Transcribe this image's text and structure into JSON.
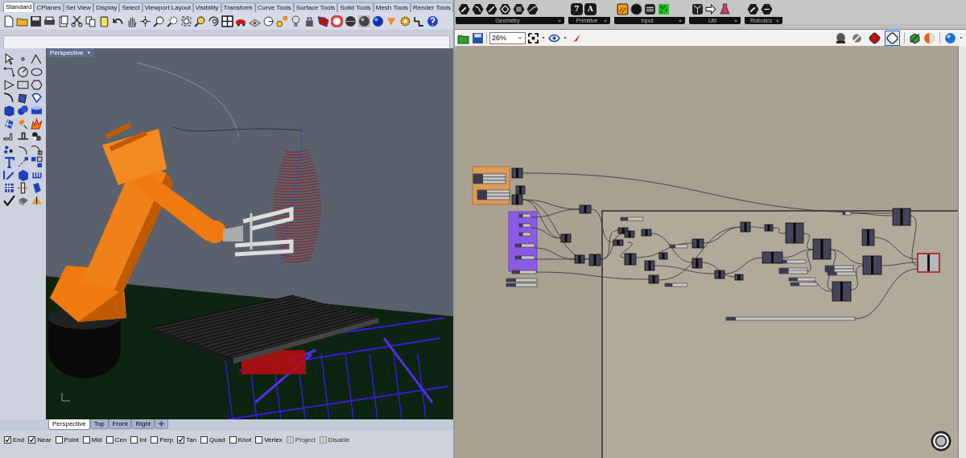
{
  "rhino": {
    "toolbar_tabs": [
      {
        "label": "Standard",
        "selected": true
      },
      {
        "label": "CPlanes",
        "selected": false
      },
      {
        "label": "Set View",
        "selected": false
      },
      {
        "label": "Display",
        "selected": false
      },
      {
        "label": "Select",
        "selected": false
      },
      {
        "label": "Viewport Layout",
        "selected": false
      },
      {
        "label": "Visibility",
        "selected": false
      },
      {
        "label": "Transform",
        "selected": false
      },
      {
        "label": "Curve Tools",
        "selected": false
      },
      {
        "label": "Surface Tools",
        "selected": false
      },
      {
        "label": "Solid Tools",
        "selected": false
      },
      {
        "label": "Mesh Tools",
        "selected": false
      },
      {
        "label": "Render Tools",
        "selected": false
      }
    ],
    "viewport": {
      "title": "Perspective"
    },
    "viewport_tabs": [
      {
        "label": "Perspective",
        "selected": true
      },
      {
        "label": "Top",
        "selected": false
      },
      {
        "label": "Front",
        "selected": false
      },
      {
        "label": "Right",
        "selected": false
      }
    ],
    "osnaps": [
      {
        "label": "End",
        "checked": true,
        "disabled": false
      },
      {
        "label": "Near",
        "checked": true,
        "disabled": false
      },
      {
        "label": "Point",
        "checked": false,
        "disabled": false
      },
      {
        "label": "Mid",
        "checked": false,
        "disabled": false
      },
      {
        "label": "Cen",
        "checked": false,
        "disabled": false
      },
      {
        "label": "Int",
        "checked": false,
        "disabled": false
      },
      {
        "label": "Perp",
        "checked": false,
        "disabled": false
      },
      {
        "label": "Tan",
        "checked": true,
        "disabled": false
      },
      {
        "label": "Quad",
        "checked": false,
        "disabled": false
      },
      {
        "label": "Knot",
        "checked": false,
        "disabled": false
      },
      {
        "label": "Vertex",
        "checked": false,
        "disabled": false
      },
      {
        "label": "Project",
        "checked": false,
        "disabled": true
      },
      {
        "label": "Disable",
        "checked": false,
        "disabled": true
      }
    ]
  },
  "grasshopper": {
    "component_groups": [
      {
        "label": "Geometry"
      },
      {
        "label": "Primitive",
        "icon_glyphs": [
          "7",
          "A"
        ]
      },
      {
        "label": "Input"
      },
      {
        "label": "Util"
      },
      {
        "label": "Robotics"
      }
    ],
    "zoom": "26%",
    "preview_modes": [
      {
        "selected": false
      },
      {
        "selected": false
      },
      {
        "selected": true
      }
    ]
  }
}
